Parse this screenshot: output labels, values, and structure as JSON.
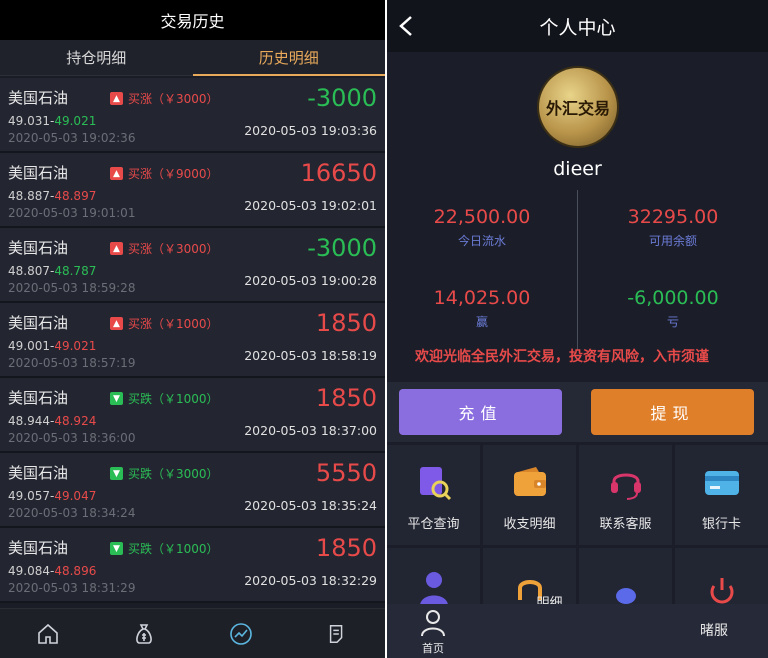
{
  "left": {
    "title": "交易历史",
    "tabs": [
      {
        "label": "持仓明细",
        "active": false
      },
      {
        "label": "历史明细",
        "active": true
      }
    ],
    "trades": [
      {
        "name": "美国石油",
        "direction": "up",
        "badge": "买涨（￥3000）",
        "price_open": "49.031",
        "price_close": "49.021",
        "close_color": "green",
        "open_time": "2020-05-03 19:02:36",
        "result": "-3000",
        "result_color": "green",
        "close_time": "2020-05-03 19:03:36"
      },
      {
        "name": "美国石油",
        "direction": "up",
        "badge": "买涨（￥9000）",
        "price_open": "48.887",
        "price_close": "48.897",
        "close_color": "red",
        "open_time": "2020-05-03 19:01:01",
        "result": "16650",
        "result_color": "red",
        "close_time": "2020-05-03 19:02:01"
      },
      {
        "name": "美国石油",
        "direction": "up",
        "badge": "买涨（￥3000）",
        "price_open": "48.807",
        "price_close": "48.787",
        "close_color": "green",
        "open_time": "2020-05-03 18:59:28",
        "result": "-3000",
        "result_color": "green",
        "close_time": "2020-05-03 19:00:28"
      },
      {
        "name": "美国石油",
        "direction": "up",
        "badge": "买涨（￥1000）",
        "price_open": "49.001",
        "price_close": "49.021",
        "close_color": "red",
        "open_time": "2020-05-03 18:57:19",
        "result": "1850",
        "result_color": "red",
        "close_time": "2020-05-03 18:58:19"
      },
      {
        "name": "美国石油",
        "direction": "down",
        "badge": "买跌（￥1000）",
        "price_open": "48.944",
        "price_close": "48.924",
        "close_color": "red",
        "open_time": "2020-05-03 18:36:00",
        "result": "1850",
        "result_color": "red",
        "close_time": "2020-05-03 18:37:00"
      },
      {
        "name": "美国石油",
        "direction": "down",
        "badge": "买跌（￥3000）",
        "price_open": "49.057",
        "price_close": "49.047",
        "close_color": "red",
        "open_time": "2020-05-03 18:34:24",
        "result": "5550",
        "result_color": "red",
        "close_time": "2020-05-03 18:35:24"
      },
      {
        "name": "美国石油",
        "direction": "down",
        "badge": "买跌（￥1000）",
        "price_open": "49.084",
        "price_close": "48.896",
        "close_color": "red",
        "open_time": "2020-05-03 18:31:29",
        "result": "1850",
        "result_color": "red",
        "close_time": "2020-05-03 18:32:29"
      }
    ],
    "nav": [
      "home-icon",
      "money-bag-icon",
      "chart-icon",
      "document-icon"
    ],
    "colors": {
      "accent": "#e8a95b",
      "up": "#e84a4a",
      "down": "#2bbd55"
    }
  },
  "right": {
    "title": "个人中心",
    "avatar_text": "外汇交易",
    "username": "dieer",
    "stats": [
      {
        "value": "22,500.00",
        "label": "今日流水",
        "color": "red"
      },
      {
        "value": "32295.00",
        "label": "可用余额",
        "color": "red"
      },
      {
        "value": "14,025.00",
        "label": "赢",
        "color": "red"
      },
      {
        "value": "-6,000.00",
        "label": "亏",
        "color": "green"
      }
    ],
    "marquee": "欢迎光临全民外汇交易，投资有风险，入市须谨",
    "buttons": {
      "recharge": "充值",
      "withdraw": "提现"
    },
    "grid": [
      {
        "label": "平仓查询",
        "icon": "document-search-icon"
      },
      {
        "label": "收支明细",
        "icon": "wallet-icon"
      },
      {
        "label": "联系客服",
        "icon": "headset-icon"
      },
      {
        "label": "银行卡",
        "icon": "bank-card-icon"
      },
      {
        "label": "",
        "icon": "user-icon"
      },
      {
        "label": "明细",
        "icon": "headphones-icon"
      },
      {
        "label": "",
        "icon": "chat-icon"
      },
      {
        "label": "",
        "icon": "power-icon"
      }
    ],
    "bottom_fragment": "暏服",
    "nav_home": "首页",
    "colors": {
      "recharge": "#8a6ee0",
      "withdraw": "#e07f2a"
    }
  }
}
